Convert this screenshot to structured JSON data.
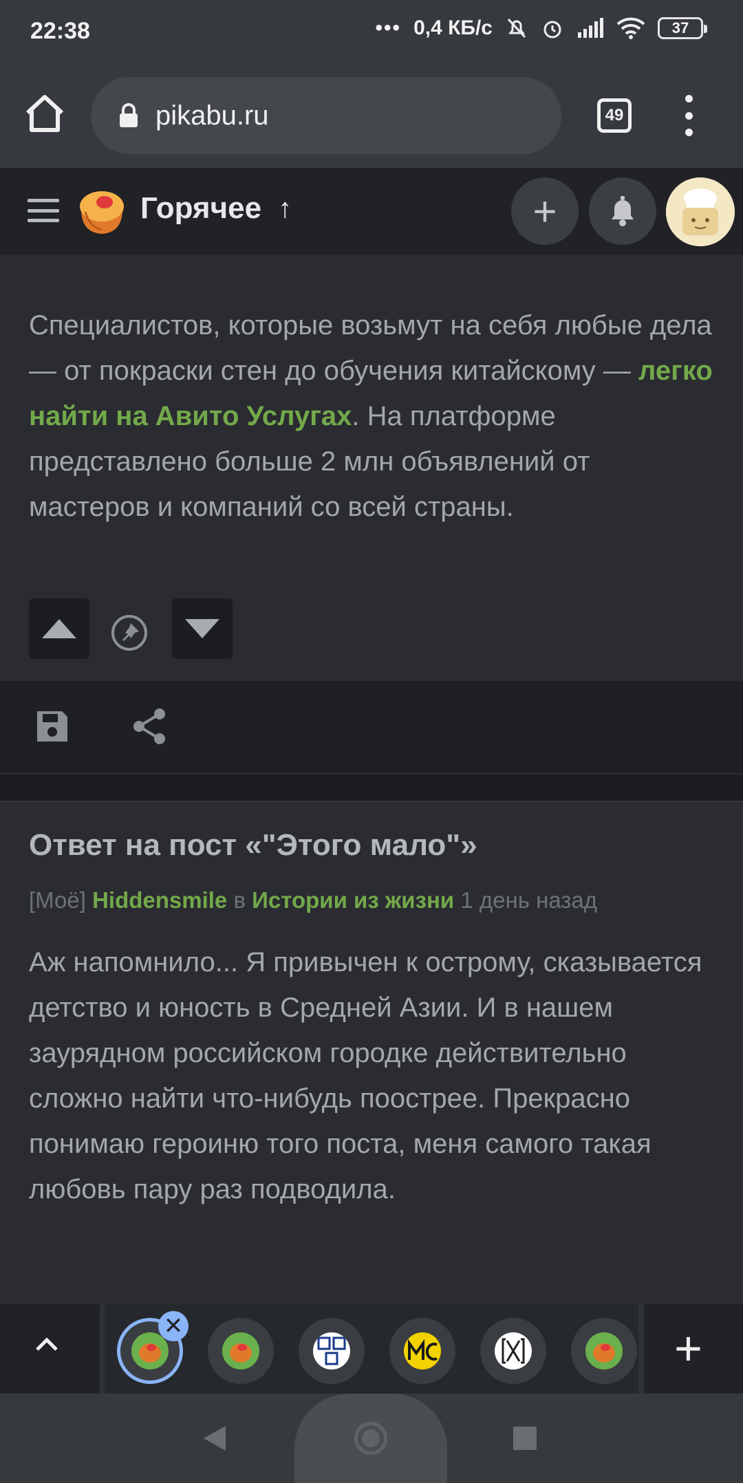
{
  "status_bar": {
    "time": "22:38",
    "network_speed": "0,4 КБ/с",
    "battery": "37"
  },
  "browser": {
    "url": "pikabu.ru",
    "tab_count": "49"
  },
  "site_header": {
    "title": "Горячее",
    "sort_arrow": "↑",
    "add_symbol": "+"
  },
  "ad_post": {
    "text_before": "Специалистов, которые возьмут на себя любые дела — от покраски стен до обучения китайскому — ",
    "link_text": "легко найти на Авито Услугах",
    "text_after": ". На платформе представлено больше 2 млн объявлений от мастеров и компаний со всей страны."
  },
  "post2": {
    "title": "Ответ на пост «\"Этого мало\"»",
    "tag": "[Моё]",
    "author": "Hiddensmile",
    "in_word": "в",
    "community": "Истории из жизни",
    "time_ago": "1 день назад",
    "body": "Аж напомнило... Я привычен к острому, сказывается детство и юность в Средней Азии. И в нашем заурядном российском городке действительно сложно найти что-нибудь поострее. Прекрасно понимаю героиню того поста, меня самого такая любовь пару раз подводила."
  },
  "tabstrip": {
    "close_symbol": "✕",
    "new_tab_symbol": "+",
    "tabs": [
      {
        "icon": "pikabu-favicon"
      },
      {
        "icon": "pikabu-favicon"
      },
      {
        "icon": "the-favicon"
      },
      {
        "icon": "mc-favicon"
      },
      {
        "icon": "bracket-favicon"
      },
      {
        "icon": "pikabu-favicon"
      }
    ]
  },
  "colors": {
    "link_green": "#73a94a",
    "accent_blue": "#8ab4f8",
    "background": "#2a2c31"
  }
}
